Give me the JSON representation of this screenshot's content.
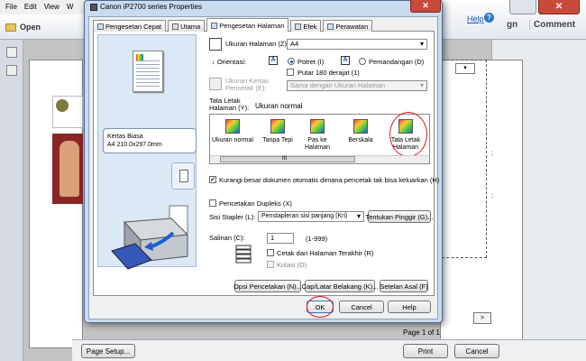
{
  "app": {
    "menu": [
      "File",
      "Edit",
      "View",
      "W"
    ],
    "open_label": "Open",
    "help_label": "Help",
    "sign_label": "gn",
    "comment_label": "Comment",
    "right_notes": [
      ":",
      ":"
    ],
    "page_info": "Page 1 of 1",
    "next_label": ">",
    "page_setup_label": "Page Setup...",
    "print_label": "Print",
    "cancel_label": "Cancel"
  },
  "dialog": {
    "title": "Canon iP2700 series Properties",
    "close_label": "✕",
    "tabs": [
      {
        "label": "Pengesetan Cepat",
        "active": false
      },
      {
        "label": "Utama",
        "active": false
      },
      {
        "label": "Pengesetan Halaman",
        "active": true
      },
      {
        "label": "Efek",
        "active": false
      },
      {
        "label": "Perawatan",
        "active": false
      }
    ],
    "paper_info": {
      "line1": "Kertas Biasa",
      "line2": "A4 210.0x297.0mm"
    },
    "page_size": {
      "label": "Ukuran Halaman (Z):",
      "value": "A4"
    },
    "orientation": {
      "label": "Orientasi:",
      "portrait": "Potret (I)",
      "landscape": "Pemandangan (D)",
      "selected": "portrait",
      "rotate_label": "Putar 180 derajat (1)"
    },
    "printer_paper": {
      "label_line1": "Ukuran Kertas",
      "label_line2": "Pencetak (E):",
      "value": "Sama dengan Ukuran Halaman"
    },
    "layout": {
      "label_line1": "Tata Letak",
      "label_line2": "Halaman (Y):",
      "current": "Ukuran normal",
      "options": [
        {
          "line1": "Ukuran normal",
          "line2": ""
        },
        {
          "line1": "Tanpa Tepi",
          "line2": ""
        },
        {
          "line1": "Pas ke",
          "line2": "Halaman"
        },
        {
          "line1": "Berskala",
          "line2": ""
        },
        {
          "line1": "Tata Letak",
          "line2": "Halaman"
        }
      ],
      "scroll_label": "III"
    },
    "reduce": {
      "label": "Kurangi besar dokumen otomatis dimana pencetak tak bisa keluarkan (H)",
      "checked": true
    },
    "duplex": {
      "label": "Pencetakan Dupleks (X)",
      "checked": false
    },
    "stapler": {
      "label": "Sisi Stapler (L):",
      "value": "Penstapleran sisi panjang (Kri)",
      "margin_button": "Tentukan Pinggir (G)..."
    },
    "copies": {
      "label": "Salinan (C):",
      "value": "1",
      "range": "(1-999)",
      "reverse_label": "Cetak dari Halaman Terakhir (R)",
      "collate_label": "Kolasi (O)"
    },
    "buttons": {
      "print_options": "Opsi Pencetakan (N)...",
      "stamp": "Cap/Latar Belakang (K)...",
      "defaults": "Setelan Asal (F)",
      "ok": "OK",
      "cancel": "Cancel",
      "help": "Help"
    }
  }
}
